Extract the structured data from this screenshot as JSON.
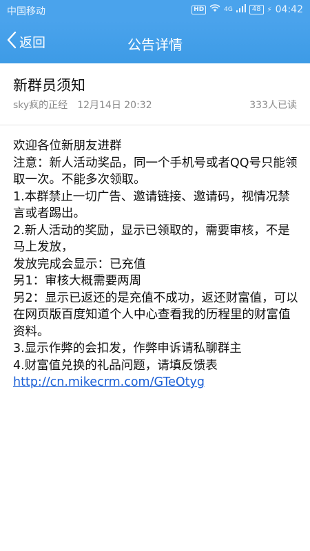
{
  "status_bar": {
    "carrier": "中国移动",
    "hd": "HD",
    "network": "4G",
    "battery": "48",
    "time": "04:42"
  },
  "nav": {
    "back_label": "返回",
    "title": "公告详情"
  },
  "announcement": {
    "title": "新群员须知",
    "author": "sky疯的正经",
    "date": "12月14日 20:32",
    "read_count": "333人已读",
    "lines": [
      "欢迎各位新朋友进群",
      "注意：新人活动奖品，同一个手机号或者QQ号只能领取一次。不能多次领取。",
      "1.本群禁止一切广告、邀请链接、邀请码，视情况禁言或者踢出。",
      "2.新人活动的奖励，显示已领取的，需要审核，不是马上发放，",
      "发放完成会显示：已充值",
      "另1：审核大概需要两周",
      "另2：显示已返还的是充值不成功，返还财富值，可以在网页版百度知道个人中心查看我的历程里的财富值资料。",
      "3.显示作弊的会扣发，作弊申诉请私聊群主",
      "4.财富值兑换的礼品问题，请填反馈表"
    ],
    "link": "http://cn.mikecrm.com/GTeOtyg"
  }
}
